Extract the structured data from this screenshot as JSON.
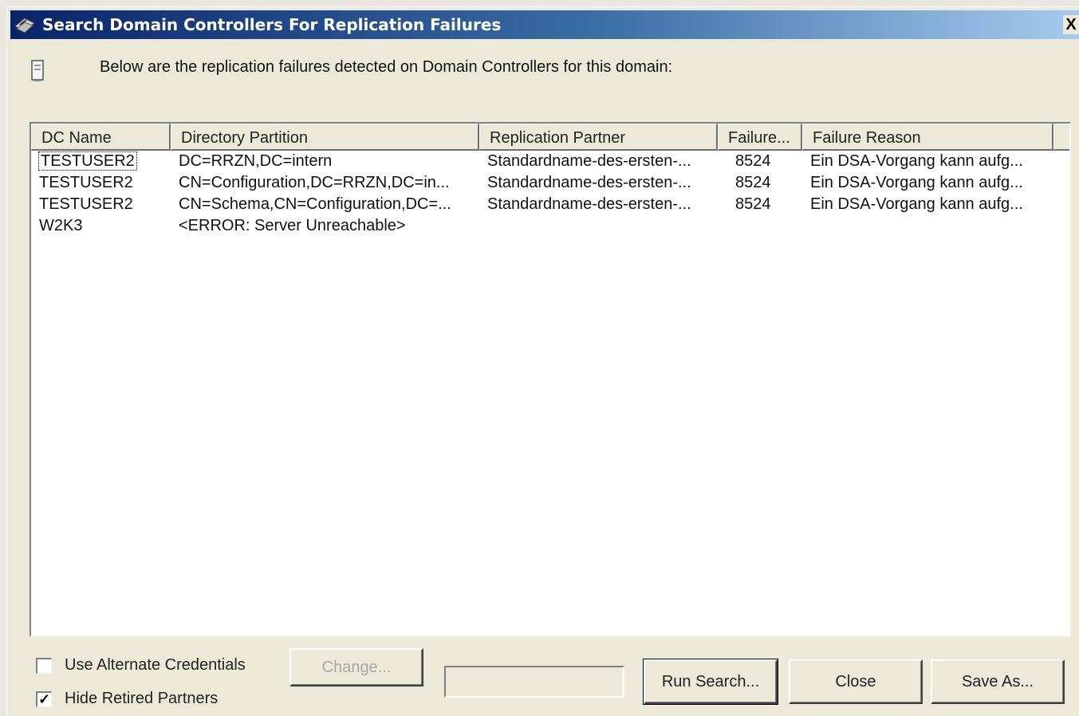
{
  "window": {
    "title": "Search Domain Controllers For Replication Failures",
    "close_glyph": "X"
  },
  "info": {
    "text": "Below are the replication failures detected on Domain Controllers for this domain:",
    "icon": "server-icon"
  },
  "table": {
    "columns": [
      "DC Name",
      "Directory Partition",
      "Replication Partner",
      "Failure...",
      "Failure Reason"
    ],
    "rows": [
      [
        "TESTUSER2",
        "DC=RRZN,DC=intern",
        "Standardname-des-ersten-...",
        "8524",
        "Ein DSA-Vorgang kann aufg..."
      ],
      [
        "TESTUSER2",
        "CN=Configuration,DC=RRZN,DC=in...",
        "Standardname-des-ersten-...",
        "8524",
        "Ein DSA-Vorgang kann aufg..."
      ],
      [
        "TESTUSER2",
        "CN=Schema,CN=Configuration,DC=...",
        "Standardname-des-ersten-...",
        "8524",
        "Ein DSA-Vorgang kann aufg..."
      ],
      [
        "W2K3",
        "<ERROR:  Server Unreachable>",
        "",
        "",
        ""
      ]
    ]
  },
  "options": {
    "use_alternate_credentials": {
      "label": "Use Alternate Credentials",
      "checked": false
    },
    "hide_retired_partners": {
      "label": "Hide Retired Partners",
      "checked": true
    }
  },
  "buttons": {
    "change": "Change...",
    "run_search": "Run Search...",
    "close": "Close",
    "save_as": "Save As..."
  },
  "colors": {
    "title_gradient_start": "#0a246a",
    "title_gradient_end": "#a6caf0",
    "dialog_bg": "#ece9d8"
  }
}
